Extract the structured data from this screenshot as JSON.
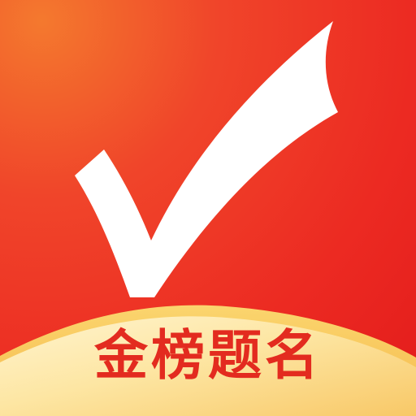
{
  "app_icon": {
    "name": "check-mark-icon",
    "banner_text": "金榜题名",
    "colors": {
      "background_top_left": "#f26b2a",
      "background_main": "#ee2b22",
      "background_bottom": "#e8201e",
      "check_mark": "#ffffff",
      "banner_light": "#fff3c9",
      "banner_gold": "#fcd77a",
      "banner_text": "#e32b1f"
    }
  }
}
